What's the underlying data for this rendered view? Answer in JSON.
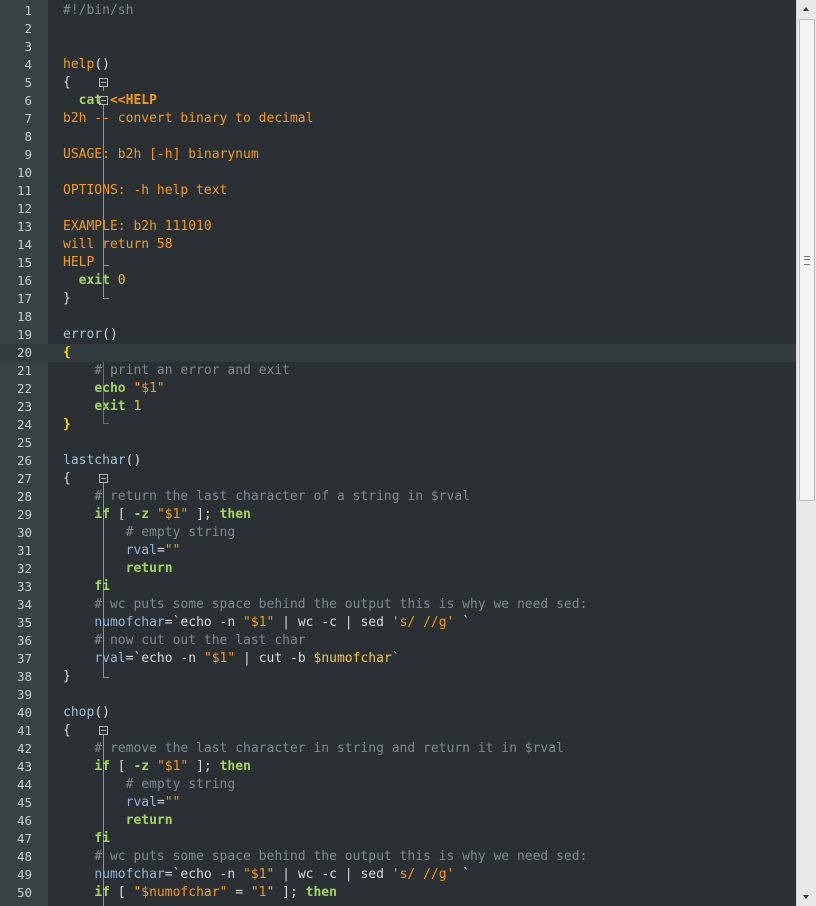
{
  "lines": [
    {
      "n": "1",
      "tokens": [
        {
          "c": "comment",
          "t": "#!/bin/sh"
        }
      ]
    },
    {
      "n": "2",
      "tokens": []
    },
    {
      "n": "3",
      "tokens": []
    },
    {
      "n": "4",
      "tokens": [
        {
          "c": "func",
          "t": "help"
        },
        {
          "c": "paren",
          "t": "()"
        }
      ]
    },
    {
      "n": "5",
      "tokens": [
        {
          "c": "brace",
          "t": "{"
        }
      ]
    },
    {
      "n": "6",
      "tokens": [
        {
          "c": "plain",
          "t": "  "
        },
        {
          "c": "keyword",
          "t": "cat"
        },
        {
          "c": "plain",
          "t": " "
        },
        {
          "c": "heredoc-op",
          "t": "<<HELP"
        }
      ]
    },
    {
      "n": "7",
      "tokens": [
        {
          "c": "heredoc",
          "t": "b2h -- convert binary to decimal"
        }
      ]
    },
    {
      "n": "8",
      "tokens": []
    },
    {
      "n": "9",
      "tokens": [
        {
          "c": "heredoc",
          "t": "USAGE: b2h [-h] binarynum"
        }
      ]
    },
    {
      "n": "10",
      "tokens": []
    },
    {
      "n": "11",
      "tokens": [
        {
          "c": "heredoc",
          "t": "OPTIONS: -h help text"
        }
      ]
    },
    {
      "n": "12",
      "tokens": []
    },
    {
      "n": "13",
      "tokens": [
        {
          "c": "heredoc",
          "t": "EXAMPLE: b2h 111010"
        }
      ]
    },
    {
      "n": "14",
      "tokens": [
        {
          "c": "heredoc",
          "t": "will return 58"
        }
      ]
    },
    {
      "n": "15",
      "tokens": [
        {
          "c": "heredoc",
          "t": "HELP"
        }
      ]
    },
    {
      "n": "16",
      "tokens": [
        {
          "c": "plain",
          "t": "  "
        },
        {
          "c": "keyword",
          "t": "exit"
        },
        {
          "c": "plain",
          "t": " "
        },
        {
          "c": "number",
          "t": "0"
        }
      ]
    },
    {
      "n": "17",
      "tokens": [
        {
          "c": "brace",
          "t": "}"
        }
      ]
    },
    {
      "n": "18",
      "tokens": []
    },
    {
      "n": "19",
      "tokens": [
        {
          "c": "funcerr",
          "t": "error"
        },
        {
          "c": "paren",
          "t": "()"
        }
      ]
    },
    {
      "n": "20",
      "tokens": [
        {
          "c": "brace-hl",
          "t": "{"
        }
      ]
    },
    {
      "n": "21",
      "tokens": [
        {
          "c": "plain",
          "t": "    "
        },
        {
          "c": "comment",
          "t": "# print an error and exit"
        }
      ]
    },
    {
      "n": "22",
      "tokens": [
        {
          "c": "plain",
          "t": "    "
        },
        {
          "c": "keyword",
          "t": "echo"
        },
        {
          "c": "plain",
          "t": " "
        },
        {
          "c": "string",
          "t": "\"$1\""
        }
      ]
    },
    {
      "n": "23",
      "tokens": [
        {
          "c": "plain",
          "t": "    "
        },
        {
          "c": "keyword",
          "t": "exit"
        },
        {
          "c": "plain",
          "t": " "
        },
        {
          "c": "number",
          "t": "1"
        }
      ]
    },
    {
      "n": "24",
      "tokens": [
        {
          "c": "brace-hl",
          "t": "}"
        }
      ]
    },
    {
      "n": "25",
      "tokens": []
    },
    {
      "n": "26",
      "tokens": [
        {
          "c": "funcerr",
          "t": "lastchar"
        },
        {
          "c": "paren",
          "t": "()"
        }
      ]
    },
    {
      "n": "27",
      "tokens": [
        {
          "c": "brace",
          "t": "{"
        }
      ]
    },
    {
      "n": "28",
      "tokens": [
        {
          "c": "plain",
          "t": "    "
        },
        {
          "c": "comment",
          "t": "# return the last character of a string in $rval"
        }
      ]
    },
    {
      "n": "29",
      "tokens": [
        {
          "c": "plain",
          "t": "    "
        },
        {
          "c": "keyword",
          "t": "if"
        },
        {
          "c": "plain",
          "t": " [ "
        },
        {
          "c": "keyword",
          "t": "-z"
        },
        {
          "c": "plain",
          "t": " "
        },
        {
          "c": "string",
          "t": "\"$1\""
        },
        {
          "c": "plain",
          "t": " ]; "
        },
        {
          "c": "keyword",
          "t": "then"
        }
      ]
    },
    {
      "n": "30",
      "tokens": [
        {
          "c": "plain",
          "t": "        "
        },
        {
          "c": "comment",
          "t": "# empty string"
        }
      ]
    },
    {
      "n": "31",
      "tokens": [
        {
          "c": "plain",
          "t": "        "
        },
        {
          "c": "var",
          "t": "rval"
        },
        {
          "c": "plain",
          "t": "="
        },
        {
          "c": "string",
          "t": "\"\""
        }
      ]
    },
    {
      "n": "32",
      "tokens": [
        {
          "c": "plain",
          "t": "        "
        },
        {
          "c": "keyword",
          "t": "return"
        }
      ]
    },
    {
      "n": "33",
      "tokens": [
        {
          "c": "plain",
          "t": "    "
        },
        {
          "c": "keyword",
          "t": "fi"
        }
      ]
    },
    {
      "n": "34",
      "tokens": [
        {
          "c": "plain",
          "t": "    "
        },
        {
          "c": "comment",
          "t": "# wc puts some space behind the output this is why we need sed:"
        }
      ]
    },
    {
      "n": "35",
      "tokens": [
        {
          "c": "plain",
          "t": "    "
        },
        {
          "c": "var",
          "t": "numofchar"
        },
        {
          "c": "plain",
          "t": "=`echo -n "
        },
        {
          "c": "string",
          "t": "\"$1\""
        },
        {
          "c": "plain",
          "t": " | wc -c | sed "
        },
        {
          "c": "string",
          "t": "'s/ //g'"
        },
        {
          "c": "plain",
          "t": " `"
        }
      ]
    },
    {
      "n": "36",
      "tokens": [
        {
          "c": "plain",
          "t": "    "
        },
        {
          "c": "comment",
          "t": "# now cut out the last char"
        }
      ]
    },
    {
      "n": "37",
      "tokens": [
        {
          "c": "plain",
          "t": "    "
        },
        {
          "c": "var",
          "t": "rval"
        },
        {
          "c": "plain",
          "t": "=`echo -n "
        },
        {
          "c": "string",
          "t": "\"$1\""
        },
        {
          "c": "plain",
          "t": " | cut -b "
        },
        {
          "c": "number",
          "t": "$numofchar"
        },
        {
          "c": "plain",
          "t": "`"
        }
      ]
    },
    {
      "n": "38",
      "tokens": [
        {
          "c": "brace",
          "t": "}"
        }
      ]
    },
    {
      "n": "39",
      "tokens": []
    },
    {
      "n": "40",
      "tokens": [
        {
          "c": "funcerr",
          "t": "chop"
        },
        {
          "c": "paren",
          "t": "()"
        }
      ]
    },
    {
      "n": "41",
      "tokens": [
        {
          "c": "brace",
          "t": "{"
        }
      ]
    },
    {
      "n": "42",
      "tokens": [
        {
          "c": "plain",
          "t": "    "
        },
        {
          "c": "comment",
          "t": "# remove the last character in string and return it in $rval"
        }
      ]
    },
    {
      "n": "43",
      "tokens": [
        {
          "c": "plain",
          "t": "    "
        },
        {
          "c": "keyword",
          "t": "if"
        },
        {
          "c": "plain",
          "t": " [ "
        },
        {
          "c": "keyword",
          "t": "-z"
        },
        {
          "c": "plain",
          "t": " "
        },
        {
          "c": "string",
          "t": "\"$1\""
        },
        {
          "c": "plain",
          "t": " ]; "
        },
        {
          "c": "keyword",
          "t": "then"
        }
      ]
    },
    {
      "n": "44",
      "tokens": [
        {
          "c": "plain",
          "t": "        "
        },
        {
          "c": "comment",
          "t": "# empty string"
        }
      ]
    },
    {
      "n": "45",
      "tokens": [
        {
          "c": "plain",
          "t": "        "
        },
        {
          "c": "var",
          "t": "rval"
        },
        {
          "c": "plain",
          "t": "="
        },
        {
          "c": "string",
          "t": "\"\""
        }
      ]
    },
    {
      "n": "46",
      "tokens": [
        {
          "c": "plain",
          "t": "        "
        },
        {
          "c": "keyword",
          "t": "return"
        }
      ]
    },
    {
      "n": "47",
      "tokens": [
        {
          "c": "plain",
          "t": "    "
        },
        {
          "c": "keyword",
          "t": "fi"
        }
      ]
    },
    {
      "n": "48",
      "tokens": [
        {
          "c": "plain",
          "t": "    "
        },
        {
          "c": "comment",
          "t": "# wc puts some space behind the output this is why we need sed:"
        }
      ]
    },
    {
      "n": "49",
      "tokens": [
        {
          "c": "plain",
          "t": "    "
        },
        {
          "c": "var",
          "t": "numofchar"
        },
        {
          "c": "plain",
          "t": "=`echo -n "
        },
        {
          "c": "string",
          "t": "\"$1\""
        },
        {
          "c": "plain",
          "t": " | wc -c | sed "
        },
        {
          "c": "string",
          "t": "'s/ //g'"
        },
        {
          "c": "plain",
          "t": " `"
        }
      ]
    },
    {
      "n": "50",
      "tokens": [
        {
          "c": "plain",
          "t": "    "
        },
        {
          "c": "keyword",
          "t": "if"
        },
        {
          "c": "plain",
          "t": " [ "
        },
        {
          "c": "string",
          "t": "\"$numofchar\""
        },
        {
          "c": "plain",
          "t": " = "
        },
        {
          "c": "string",
          "t": "\"1\""
        },
        {
          "c": "plain",
          "t": " ]; "
        },
        {
          "c": "keyword",
          "t": "then"
        }
      ]
    }
  ],
  "current_line": "20",
  "icons": {
    "fold": "fold-minus-icon",
    "scroll_up": "arrow-up-icon",
    "scroll_down": "arrow-down-icon",
    "grip": "scroll-grip-icon"
  },
  "colors": {
    "background": "#2a3033",
    "gutter": "#394145",
    "keyword": "#a3d65e",
    "string": "#f39a1d",
    "comment": "#7f8a8f",
    "brace_match": "#ffd400",
    "fold_active": "#d0453b"
  }
}
